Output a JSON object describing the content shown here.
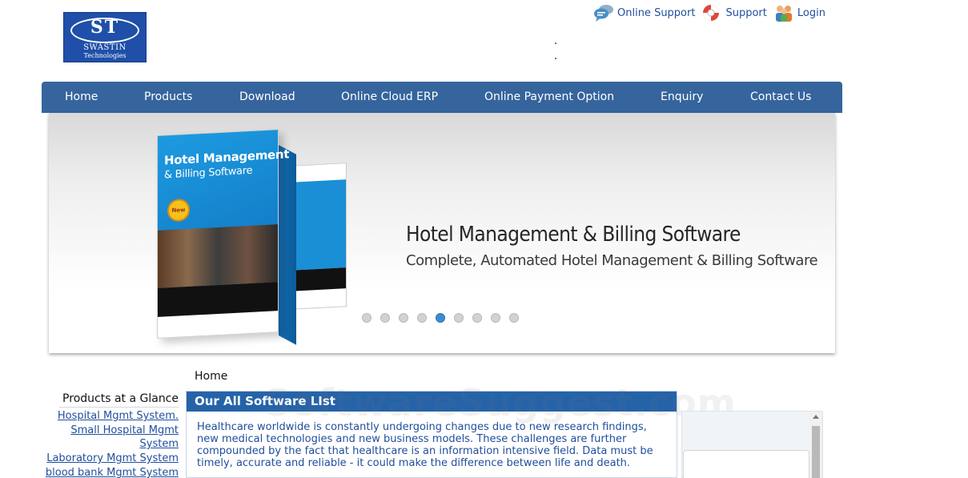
{
  "logo": {
    "initials": "ST",
    "name": "SWASTIN",
    "subtitle": "Technologies"
  },
  "toplinks": [
    {
      "label": "Online Support",
      "icon": "chat-bubbles-icon"
    },
    {
      "label": "Support",
      "icon": "lifebuoy-icon"
    },
    {
      "label": "Login",
      "icon": "users-icon"
    }
  ],
  "nav": {
    "items": [
      {
        "label": "Home"
      },
      {
        "label": "Products"
      },
      {
        "label": "Download"
      },
      {
        "label": "Online Cloud ERP"
      },
      {
        "label": "Online Payment Option"
      },
      {
        "label": "Enquiry"
      },
      {
        "label": "Contact Us"
      }
    ],
    "color": "#36649d"
  },
  "banner": {
    "title": "Hotel Management & Billing Software",
    "subtitle": "Complete, Automated Hotel Management & Billing Software",
    "box_title_line1": "Hotel Management",
    "box_title_line2": "& Billing Software",
    "box_badge": "New",
    "slides": 9,
    "active_slide": 5
  },
  "breadcrumb": "Home",
  "sidebar": {
    "title": "Products at a Glance",
    "links": [
      "Hospital Mgmt System.",
      "Small Hospital Mgmt System",
      "Laboratory Mgmt System",
      "blood bank Mgmt System"
    ]
  },
  "panel": {
    "title": "Our All Software LIst",
    "body": "Healthcare worldwide is constantly undergoing changes due to new research findings, new medical technologies and new business models. These challenges are further compounded by the fact that healthcare is an information intensive field. Data must be timely, accurate and reliable - it could make the difference between life and death.",
    "header_color": "#2563a9"
  },
  "watermark": "SoftwareSuggest.com"
}
